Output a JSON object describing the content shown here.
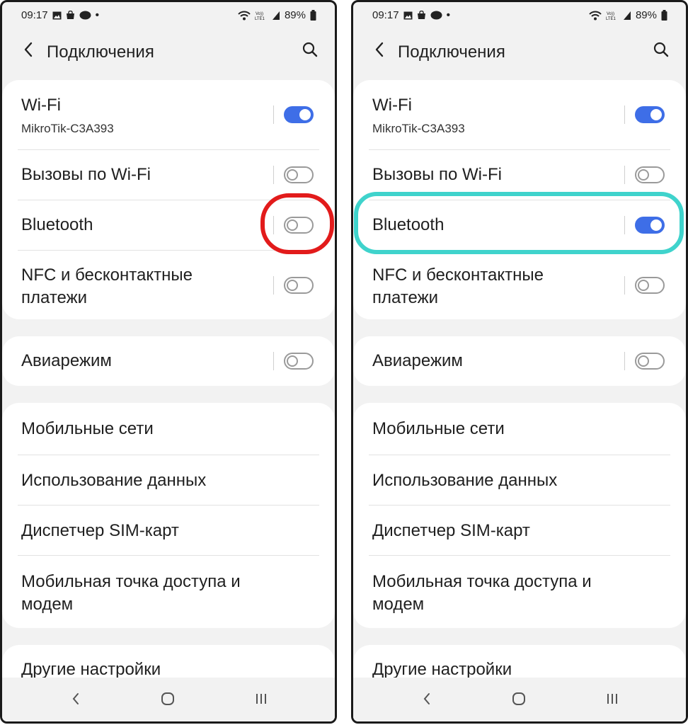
{
  "screens": [
    {
      "status": {
        "time": "09:17",
        "dot": "•",
        "battery": "89%",
        "volte": "VoLTE1"
      },
      "header": {
        "title": "Подключения"
      },
      "rows": {
        "wifi": {
          "title": "Wi-Fi",
          "subtitle": "MikroTik-C3A393",
          "toggle": "on"
        },
        "wifi_calls": {
          "title": "Вызовы по Wi-Fi",
          "toggle": "off"
        },
        "bluetooth": {
          "title": "Bluetooth",
          "toggle": "off"
        },
        "nfc": {
          "title_line1": "NFC и бесконтактные",
          "title_line2": "платежи",
          "toggle": "off"
        },
        "airplane": {
          "title": "Авиарежим",
          "toggle": "off"
        },
        "mobile_networks": {
          "title": "Мобильные сети"
        },
        "data_usage": {
          "title": "Использование данных"
        },
        "sim_manager": {
          "title": "Диспетчер SIM-карт"
        },
        "hotspot": {
          "title_line1": "Мобильная точка доступа и",
          "title_line2": "модем"
        },
        "more": {
          "title": "Другие настройки"
        }
      },
      "highlight_color": "#e21b1b"
    },
    {
      "status": {
        "time": "09:17",
        "dot": "•",
        "battery": "89%",
        "volte": "VoLTE1"
      },
      "header": {
        "title": "Подключения"
      },
      "rows": {
        "wifi": {
          "title": "Wi-Fi",
          "subtitle": "MikroTik-C3A393",
          "toggle": "on"
        },
        "wifi_calls": {
          "title": "Вызовы по Wi-Fi",
          "toggle": "off"
        },
        "bluetooth": {
          "title": "Bluetooth",
          "toggle": "on"
        },
        "nfc": {
          "title_line1": "NFC и бесконтактные",
          "title_line2": "платежи",
          "toggle": "off"
        },
        "airplane": {
          "title": "Авиарежим",
          "toggle": "off"
        },
        "mobile_networks": {
          "title": "Мобильные сети"
        },
        "data_usage": {
          "title": "Использование данных"
        },
        "sim_manager": {
          "title": "Диспетчер SIM-карт"
        },
        "hotspot": {
          "title_line1": "Мобильная точка доступа и",
          "title_line2": "модем"
        },
        "more": {
          "title": "Другие настройки"
        }
      },
      "highlight_color": "#3fd3cc"
    }
  ],
  "colors": {
    "toggle_on": "#3e6ee7",
    "toggle_off": "#9a9a9a",
    "card": "#ffffff",
    "background": "#f2f2f2"
  }
}
